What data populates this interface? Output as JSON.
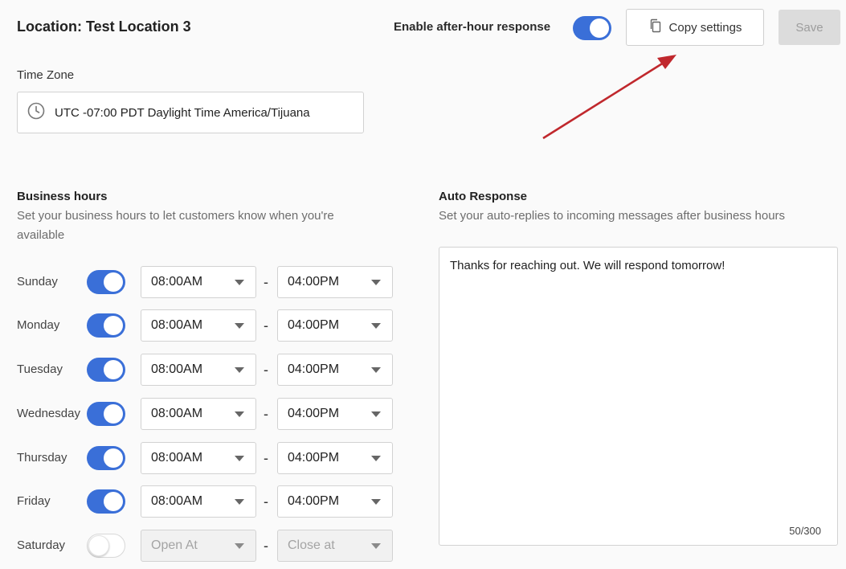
{
  "header": {
    "location_title": "Location: Test Location 3",
    "enable_label": "Enable after-hour response",
    "enable_on": true,
    "copy_label": "Copy settings",
    "save_label": "Save"
  },
  "timezone": {
    "label": "Time Zone",
    "value": "UTC -07:00 PDT Daylight Time America/Tijuana"
  },
  "business_hours": {
    "title": "Business hours",
    "description": "Set your business hours to let customers know when you're available",
    "desc_line1": "Set your business hours to let customers know when you're",
    "desc_line2": "available",
    "days": [
      {
        "name": "Sunday",
        "enabled": true,
        "open": "08:00AM",
        "close": "04:00PM"
      },
      {
        "name": "Monday",
        "enabled": true,
        "open": "08:00AM",
        "close": "04:00PM"
      },
      {
        "name": "Tuesday",
        "enabled": true,
        "open": "08:00AM",
        "close": "04:00PM"
      },
      {
        "name": "Wednesday",
        "enabled": true,
        "open": "08:00AM",
        "close": "04:00PM"
      },
      {
        "name": "Thursday",
        "enabled": true,
        "open": "08:00AM",
        "close": "04:00PM"
      },
      {
        "name": "Friday",
        "enabled": true,
        "open": "08:00AM",
        "close": "04:00PM"
      },
      {
        "name": "Saturday",
        "enabled": false,
        "open": "Open At",
        "close": "Close at"
      }
    ],
    "separator": "-"
  },
  "auto_response": {
    "title": "Auto Response",
    "description": "Set your auto-replies to incoming messages after business hours",
    "message": "Thanks for reaching out. We will respond tomorrow!",
    "char_count": "50/300"
  },
  "colors": {
    "accent": "#3a6fd8",
    "arrow": "#c0282d"
  },
  "icons": {
    "copy": "copy-icon",
    "clock": "clock-icon",
    "caret": "caret-down-icon"
  }
}
